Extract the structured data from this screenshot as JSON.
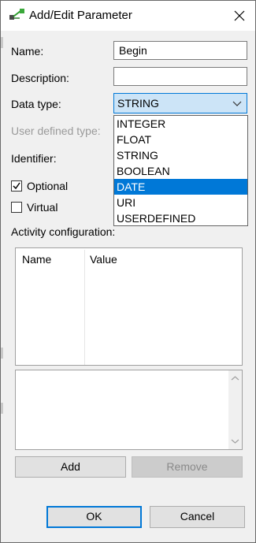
{
  "window": {
    "title": "Add/Edit Parameter",
    "app_icon": "parameter-app-icon",
    "close_icon": "close-icon"
  },
  "form": {
    "name_label": "Name:",
    "name_value": "Begin",
    "description_label": "Description:",
    "description_value": "",
    "data_type_label": "Data type:",
    "data_type_value": "STRING",
    "user_defined_type_label": "User defined type:",
    "identifier_label": "Identifier:",
    "optional_label": "Optional",
    "optional_checked": true,
    "virtual_label": "Virtual",
    "virtual_checked": false,
    "activity_configuration_label": "Activity configuration:"
  },
  "dropdown": {
    "options": [
      "INTEGER",
      "FLOAT",
      "STRING",
      "BOOLEAN",
      "DATE",
      "URI",
      "USERDEFINED"
    ],
    "highlighted": "DATE"
  },
  "table": {
    "columns": [
      "Name",
      "Value"
    ],
    "rows": []
  },
  "buttons": {
    "add": "Add",
    "remove": "Remove",
    "ok": "OK",
    "cancel": "Cancel"
  },
  "colors": {
    "selection": "#0078d7",
    "combo_background": "#cce4f7",
    "dialog_background": "#f0f0f0"
  }
}
